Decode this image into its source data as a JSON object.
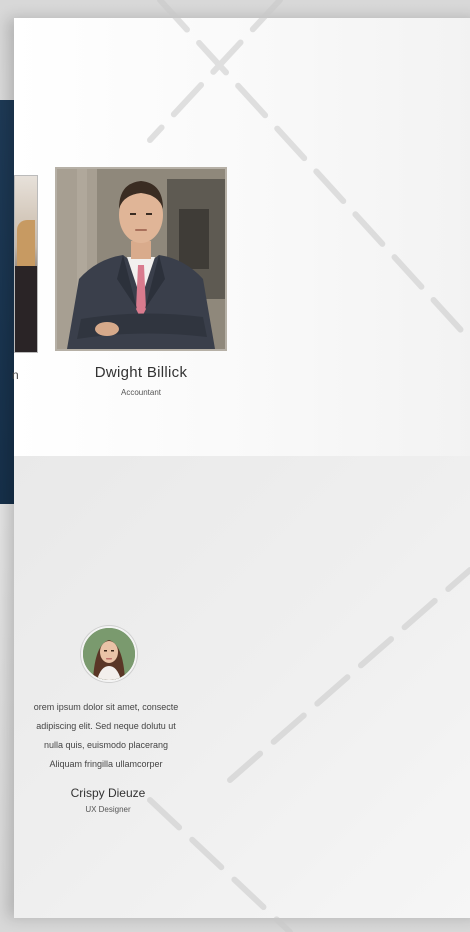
{
  "team": {
    "partial_member": {
      "name": "n"
    },
    "member": {
      "name": "Dwight Billick",
      "role": "Accountant"
    }
  },
  "testimonial": {
    "lines": [
      "orem ipsum dolor sit amet, consecte",
      "adipiscing elit. Sed neque dolutu ut",
      "nulla quis, euismodo placerang",
      "Aliquam fringilla ullamcorper"
    ],
    "author_name": "Crispy Dieuze",
    "author_role": "UX Designer"
  },
  "colors": {
    "dark_panel": "#1e3a56",
    "page": "#ffffff",
    "lower_band": "#ececec"
  }
}
